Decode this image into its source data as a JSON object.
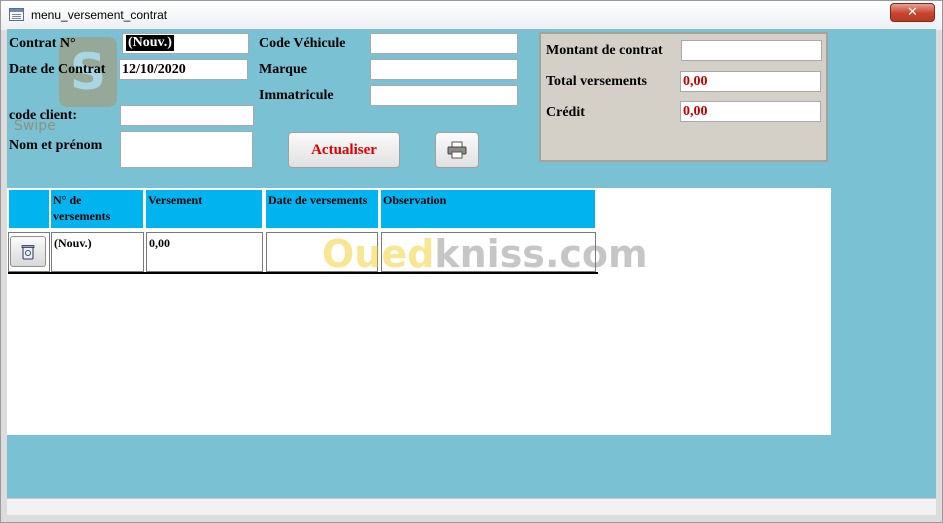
{
  "window": {
    "title": "menu_versement_contrat",
    "close_label": "✕"
  },
  "form": {
    "contrat_no_label": "Contrat N°",
    "contrat_no_value": "(Nouv.)",
    "date_contrat_label": "Date de Contrat",
    "date_contrat_value": "12/10/2020",
    "code_client_label": "code client:",
    "code_client_value": "",
    "nom_prenom_label": "Nom et prénom",
    "nom_prenom_value": "",
    "code_vehicule_label": "Code Véhicule",
    "code_vehicule_value": "",
    "marque_label": "Marque",
    "marque_value": "",
    "immatricule_label": "Immatricule",
    "immatricule_value": ""
  },
  "summary": {
    "montant_label": "Montant de contrat",
    "montant_value": "",
    "total_label": "Total versements",
    "total_value": "0,00",
    "credit_label": "Crédit",
    "credit_value": "0,00"
  },
  "buttons": {
    "actualiser_label": "Actualiser",
    "print_icon": "printer-icon",
    "delete_icon": "trash-icon"
  },
  "table": {
    "columns": [
      "N° de versements",
      "Versement",
      "Date de versements",
      "Observation"
    ],
    "rows": [
      {
        "no": "(Nouv.)",
        "versement": "0,00",
        "date": "",
        "observation": ""
      }
    ]
  },
  "watermark": {
    "brand_a": "Oued",
    "brand_b": "kniss",
    "brand_c": ".com",
    "logo_text": "Swipe"
  },
  "colors": {
    "form_bg": "#7bc1d4",
    "header_bg": "#00b4ef",
    "accent_red": "#c00000"
  }
}
